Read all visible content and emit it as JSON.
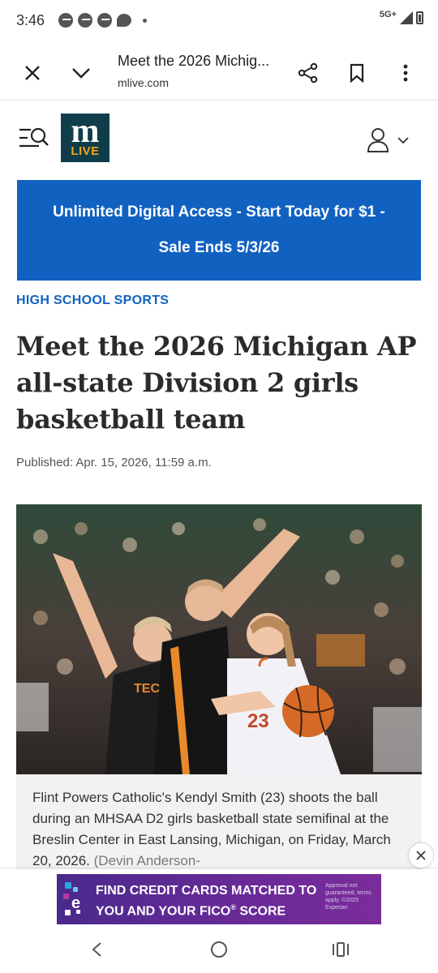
{
  "status_bar": {
    "time": "3:46",
    "network": "5G+",
    "notification_icons": [
      "messenger-icon",
      "messenger-icon",
      "messenger-icon",
      "chat-bubble-icon"
    ]
  },
  "browser": {
    "page_title": "Meet the 2026 Michig...",
    "domain": "mlive.com",
    "icons": [
      "close-icon",
      "chevron-down-icon",
      "share-icon",
      "bookmark-icon",
      "more-vert-icon"
    ]
  },
  "site": {
    "logo_top": "m",
    "logo_bottom": "LIVE",
    "logo_color": "#0f3d4a",
    "logo_accent": "#f4a11b"
  },
  "promo": {
    "line1": "Unlimited Digital Access - Start Today for $1 -",
    "line2": "Sale Ends 5/3/26",
    "color": "#1161c1"
  },
  "article": {
    "section": "HIGH SCHOOL SPORTS",
    "headline": "Meet the 2026 Michigan AP all-state Division 2 girls basketball team",
    "published": "Published: Apr. 15, 2026, 11:59 a.m.",
    "caption": "Flint Powers Catholic's Kendyl Smith (23) shoots the ball during an MHSAA D2 girls basketball state semifinal at the Breslin Center in East Lansing, Michigan, on Friday, March 20, 2026.",
    "caption_credit": "(Devin Anderson-",
    "photo_jersey_number": "23",
    "photo_jersey_text": "TECH"
  },
  "ad": {
    "text_line1": "FIND CREDIT CARDS MATCHED TO",
    "text_line2": "YOU AND YOUR FICO",
    "text_line2_mark": "®",
    "text_line2_end": " SCORE",
    "fine_print": "Approval not guaranteed, terms apply. ©2025 Experian",
    "logo_letter": "e"
  }
}
